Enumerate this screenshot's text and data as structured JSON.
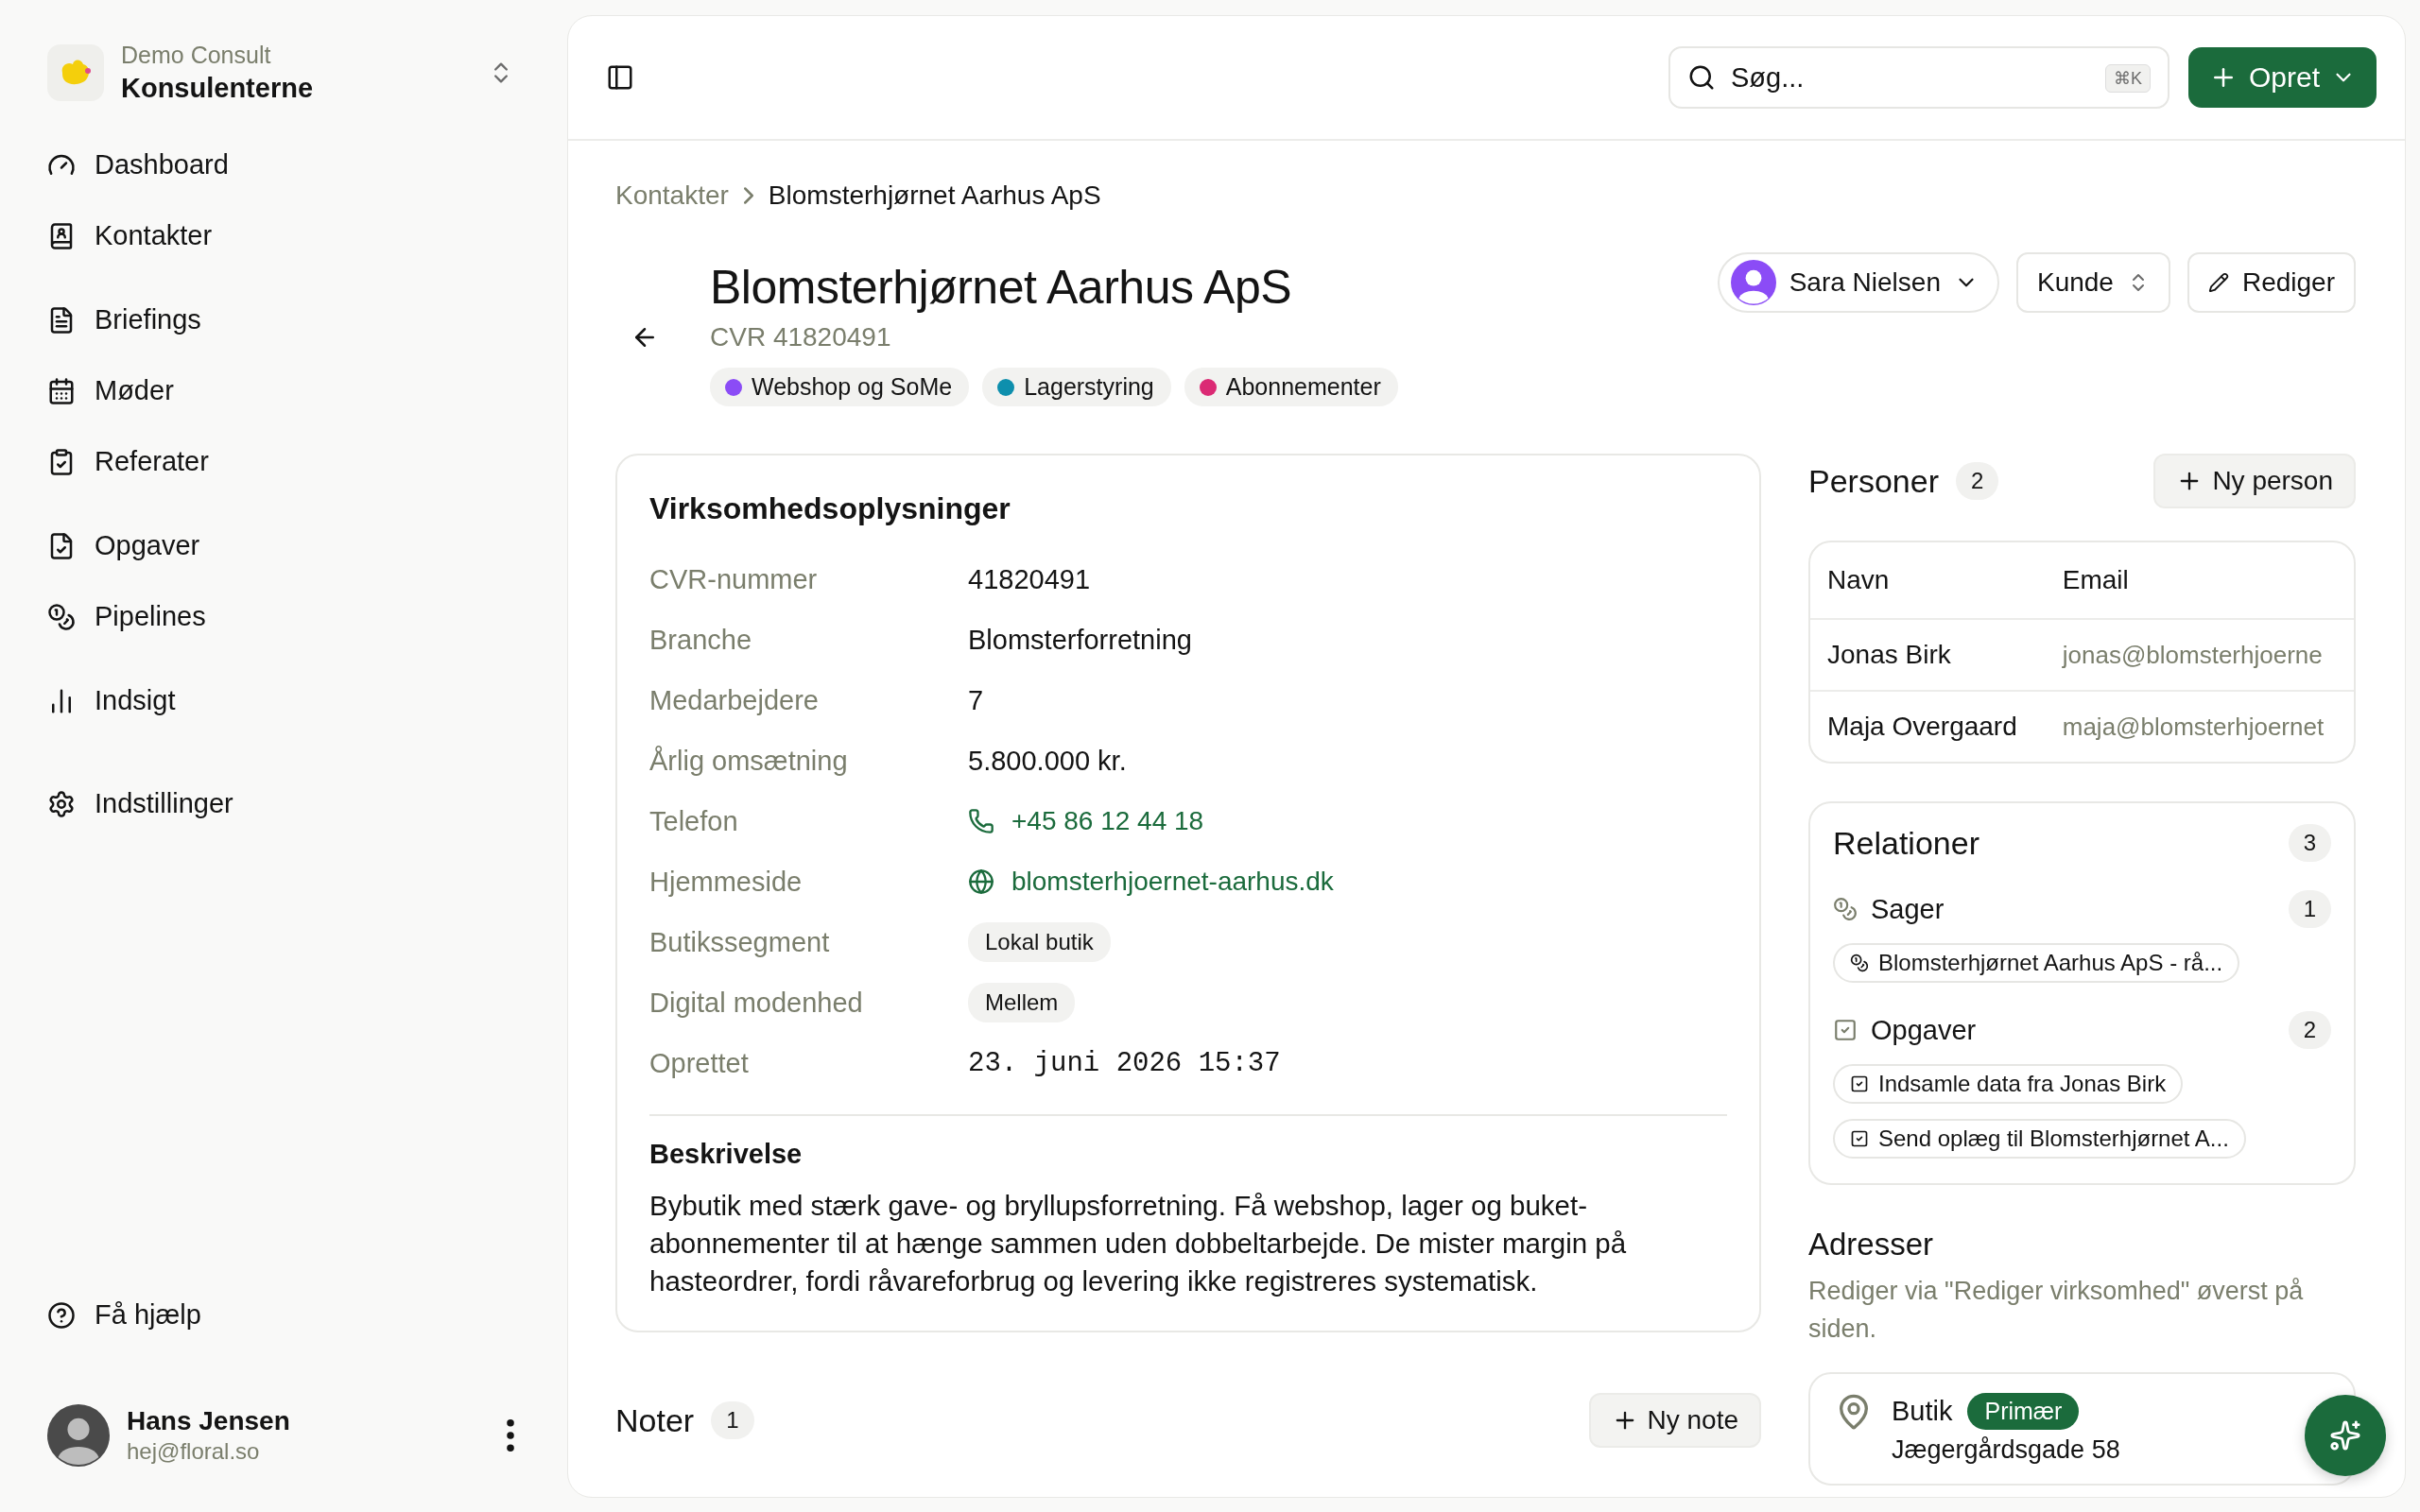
{
  "sidebar": {
    "org": {
      "caption": "Demo Consult",
      "name": "Konsulenterne"
    },
    "nav_groups": [
      [
        "Dashboard",
        "Kontakter"
      ],
      [
        "Briefings",
        "Møder",
        "Referater"
      ],
      [
        "Opgaver",
        "Pipelines"
      ],
      [
        "Indsigt"
      ],
      [
        "Indstillinger"
      ]
    ],
    "help": "Få hjælp",
    "user": {
      "name": "Hans Jensen",
      "email": "hej@floral.so"
    }
  },
  "header": {
    "search": {
      "placeholder": "Søg...",
      "shortcut": "⌘K"
    },
    "create_button": "Opret"
  },
  "breadcrumb": [
    "Kontakter",
    "Blomsterhjørnet Aarhus ApS"
  ],
  "company": {
    "title": "Blomsterhjørnet Aarhus ApS",
    "cvr": "CVR 41820491",
    "tags": [
      {
        "label": "Webshop og SoMe",
        "color": "#8b4cf6"
      },
      {
        "label": "Lagerstyring",
        "color": "#0e8fad"
      },
      {
        "label": "Abonnementer",
        "color": "#db2a74"
      }
    ],
    "owner": "Sara Nielsen",
    "status": "Kunde",
    "edit_button": "Rediger"
  },
  "details": {
    "title": "Virksomhedsoplysninger",
    "rows": [
      {
        "label": "CVR-nummer",
        "value": "41820491",
        "kind": "text"
      },
      {
        "label": "Branche",
        "value": "Blomsterforretning",
        "kind": "text"
      },
      {
        "label": "Medarbejdere",
        "value": "7",
        "kind": "text"
      },
      {
        "label": "Årlig omsætning",
        "value": "5.800.000 kr.",
        "kind": "text"
      },
      {
        "label": "Telefon",
        "value": "+45 86 12 44 18",
        "kind": "phone"
      },
      {
        "label": "Hjemmeside",
        "value": "blomsterhjoernet-aarhus.dk",
        "kind": "web"
      },
      {
        "label": "Butikssegment",
        "value": "Lokal butik",
        "kind": "chip"
      },
      {
        "label": "Digital modenhed",
        "value": "Mellem",
        "kind": "chip"
      },
      {
        "label": "Oprettet",
        "value": "23. juni 2026 15:37",
        "kind": "mono"
      }
    ],
    "description_title": "Beskrivelse",
    "description": "Bybutik med stærk gave- og bryllupsforretning. Få webshop, lager og buket-abonnementer til at hænge sammen uden dobbeltarbejde. De mister margin på hasteordrer, fordi råvareforbrug og levering ikke registreres systematisk."
  },
  "notes": {
    "title": "Noter",
    "count": "1",
    "add_button": "Ny note"
  },
  "persons": {
    "title": "Personer",
    "count": "2",
    "add_button": "Ny person",
    "columns": [
      "Navn",
      "Email"
    ],
    "rows": [
      {
        "name": "Jonas Birk",
        "email": "jonas@blomsterhjoerne"
      },
      {
        "name": "Maja Overgaard",
        "email": "maja@blomsterhjoernet"
      }
    ]
  },
  "relations": {
    "title": "Relationer",
    "count": "3",
    "groups": [
      {
        "kind": "cases",
        "label": "Sager",
        "count": "1",
        "items": [
          "Blomsterhjørnet Aarhus ApS - rå..."
        ]
      },
      {
        "kind": "tasks",
        "label": "Opgaver",
        "count": "2",
        "items": [
          "Indsamle data fra Jonas Birk",
          "Send oplæg til Blomsterhjørnet A..."
        ]
      }
    ]
  },
  "addresses": {
    "title": "Adresser",
    "hint": "Rediger via \"Rediger virksomhed\" øverst på siden.",
    "items": [
      {
        "label": "Butik",
        "badge": "Primær",
        "line": "Jægergårdsgade 58"
      }
    ]
  }
}
